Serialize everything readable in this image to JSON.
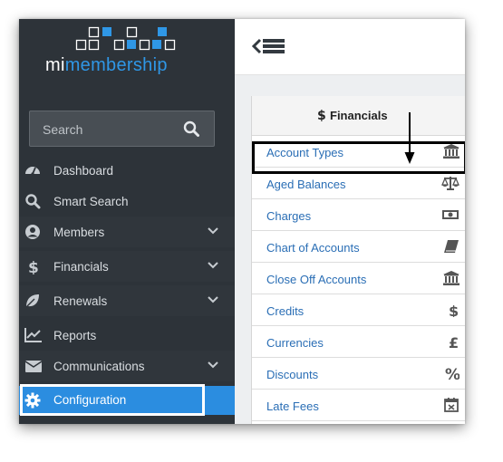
{
  "brand": {
    "prefix": "mi",
    "suffix": "membership"
  },
  "search": {
    "placeholder": "Search"
  },
  "sidebar": {
    "items": [
      {
        "label": "Dashboard",
        "icon": "dashboard-icon"
      },
      {
        "label": "Smart Search",
        "icon": "search-icon"
      },
      {
        "label": "Members",
        "icon": "user-circle-icon",
        "expandable": true
      },
      {
        "label": "Financials",
        "icon": "dollar-icon",
        "expandable": true
      },
      {
        "label": "Renewals",
        "icon": "leaf-icon",
        "expandable": true
      },
      {
        "label": "Reports",
        "icon": "line-chart-icon"
      },
      {
        "label": "Communications",
        "icon": "envelope-icon",
        "expandable": true
      }
    ],
    "active": {
      "label": "Configuration",
      "icon": "gear-icon"
    }
  },
  "panel": {
    "header": "Financials",
    "header_icon": "dollar-icon",
    "items": [
      {
        "label": "Account Types",
        "icon": "bank-icon"
      },
      {
        "label": "Aged Balances",
        "icon": "balance-scale-icon"
      },
      {
        "label": "Charges",
        "icon": "money-icon"
      },
      {
        "label": "Chart of Accounts",
        "icon": "book-icon"
      },
      {
        "label": "Close Off Accounts",
        "icon": "bank-icon"
      },
      {
        "label": "Credits",
        "icon": "dollar-icon"
      },
      {
        "label": "Currencies",
        "icon": "pound-icon"
      },
      {
        "label": "Discounts",
        "icon": "percent-icon"
      },
      {
        "label": "Late Fees",
        "icon": "calendar-x-icon"
      }
    ]
  },
  "colors": {
    "sidebar_bg": "#2d3339",
    "accent": "#2b8de0",
    "link": "#2a6eb5"
  }
}
